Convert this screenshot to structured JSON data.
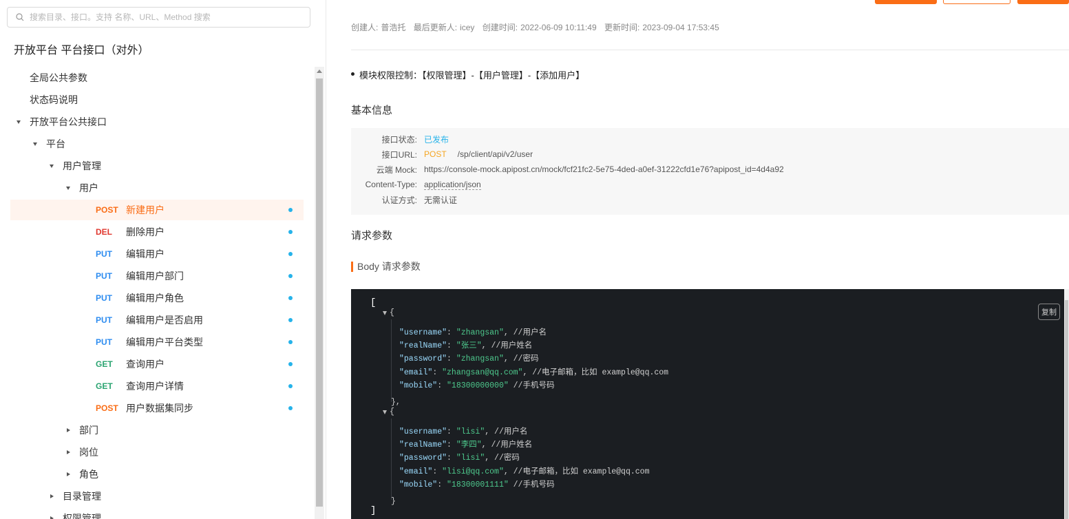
{
  "search": {
    "placeholder": "搜索目录、接口。支持 名称、URL、Method 搜索"
  },
  "project": {
    "title": "开放平台 平台接口（对外）"
  },
  "tree": {
    "global_params": "全局公共参数",
    "status_codes": "状态码说明",
    "open_public": "开放平台公共接口",
    "platform": "平台",
    "user_mgmt": "用户管理",
    "user": "用户",
    "apis": [
      {
        "method": "POST",
        "name": "新建用户",
        "color": "#fa6d16",
        "active": true
      },
      {
        "method": "DEL",
        "name": "删除用户",
        "color": "#e0382f"
      },
      {
        "method": "PUT",
        "name": "编辑用户",
        "color": "#2d8cf0"
      },
      {
        "method": "PUT",
        "name": "编辑用户部门",
        "color": "#2d8cf0"
      },
      {
        "method": "PUT",
        "name": "编辑用户角色",
        "color": "#2d8cf0"
      },
      {
        "method": "PUT",
        "name": "编辑用户是否启用",
        "color": "#2d8cf0"
      },
      {
        "method": "PUT",
        "name": "编辑用户平台类型",
        "color": "#2d8cf0"
      },
      {
        "method": "GET",
        "name": "查询用户",
        "color": "#2ba471"
      },
      {
        "method": "GET",
        "name": "查询用户详情",
        "color": "#2ba471"
      },
      {
        "method": "POST",
        "name": "用户数据集同步",
        "color": "#fa6d16"
      }
    ],
    "dept": "部门",
    "position": "岗位",
    "role": "角色",
    "dir_mgmt": "目录管理",
    "perm_mgmt": "权限管理"
  },
  "meta": {
    "creator_label": "创建人:",
    "creator": "普浩托",
    "updater_label": "最后更新人:",
    "updater": "icey",
    "created_label": "创建时间:",
    "created": "2022-06-09 10:11:49",
    "updated_label": "更新时间:",
    "updated": "2023-09-04 17:53:45"
  },
  "permission_line": "模块权限控制：【权限管理】-【用户管理】-【添加用户】",
  "basic_info": {
    "title": "基本信息",
    "status_label": "接口状态:",
    "status": "已发布",
    "url_label": "接口URL:",
    "url_method": "POST",
    "url": "/sp/client/api/v2/user",
    "mock_label": "云端 Mock:",
    "mock": "https://console-mock.apipost.cn/mock/fcf21fc2-5e75-4ded-a0ef-31222cfd1e76?apipost_id=4d4a92",
    "ctype_label": "Content-Type:",
    "ctype": "application/json",
    "auth_label": "认证方式:",
    "auth": "无需认证"
  },
  "request": {
    "title": "请求参数",
    "body_title": "Body 请求参数",
    "copy_label": "复制"
  },
  "code": {
    "open_bracket": "[",
    "close_bracket": "]",
    "open_brace": "{",
    "close_brace_comma": "},",
    "close_brace": "}",
    "users": [
      {
        "rows": [
          {
            "k": "\"username\"",
            "v": "\"zhangsan\"",
            "tail": ", //用户名"
          },
          {
            "k": "\"realName\"",
            "v": "\"张三\"",
            "tail": ", //用户姓名"
          },
          {
            "k": "\"password\"",
            "v": "\"zhangsan\"",
            "tail": ", //密码"
          },
          {
            "k": "\"email\"",
            "v": "\"zhangsan@qq.com\"",
            "tail": ", //电子邮箱，比如 example@qq.com"
          },
          {
            "k": "\"mobile\"",
            "v": "\"18300000000\"",
            "tail": " //手机号码"
          }
        ]
      },
      {
        "rows": [
          {
            "k": "\"username\"",
            "v": "\"lisi\"",
            "tail": ", //用户名"
          },
          {
            "k": "\"realName\"",
            "v": "\"李四\"",
            "tail": ", //用户姓名"
          },
          {
            "k": "\"password\"",
            "v": "\"lisi\"",
            "tail": ", //密码"
          },
          {
            "k": "\"email\"",
            "v": "\"lisi@qq.com\"",
            "tail": ", //电子邮箱，比如 example@qq.com"
          },
          {
            "k": "\"mobile\"",
            "v": "\"18300001111\"",
            "tail": " //手机号码"
          }
        ]
      }
    ]
  },
  "colors": {
    "accent": "#fa6d16",
    "published": "#26b3ea",
    "code_bg": "#1b1e22"
  }
}
